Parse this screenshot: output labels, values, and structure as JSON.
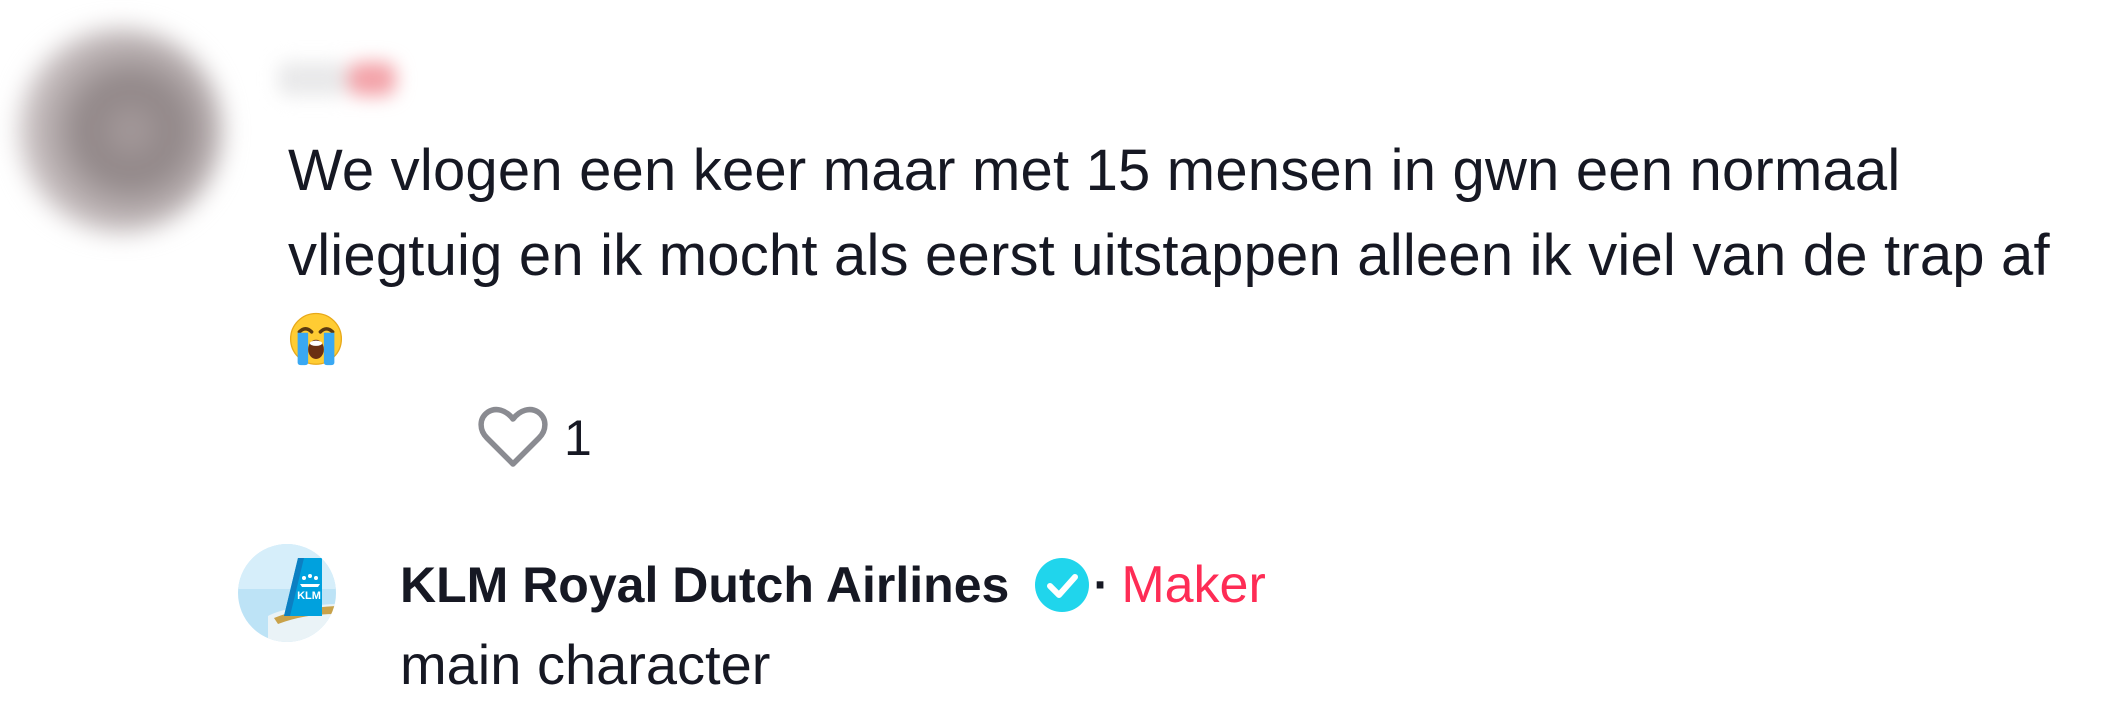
{
  "comment": {
    "text_before_emoji": "We vlogen een keer maar met 15 mensen in gwn een normaal vliegtuig en ik mocht als eerst uitstappen alleen ik viel van de trap af",
    "emoji": "loudly-crying-face",
    "likes": "1",
    "like_icon": "heart-outline-icon"
  },
  "reply": {
    "author": "KLM Royal Dutch Airlines",
    "verified_icon": "verified-badge-icon",
    "separator": "·",
    "badge": "Maker",
    "text": "main character",
    "avatar_logo_text": "KLM"
  },
  "colors": {
    "text": "#161823",
    "maker_accent": "#fe2c55",
    "verified": "#20d5ec",
    "like_icon": "#8a8b91"
  }
}
